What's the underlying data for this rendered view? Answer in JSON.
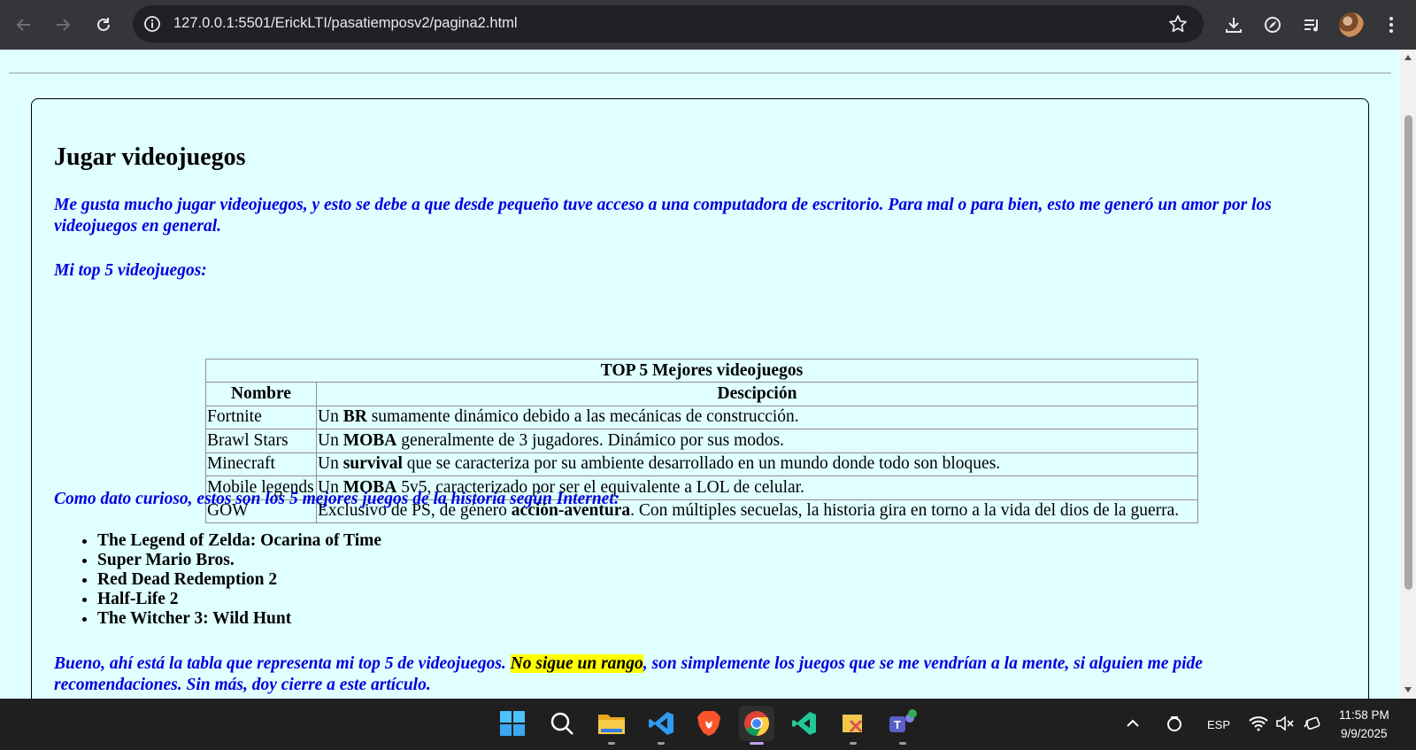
{
  "browser": {
    "url": "127.0.0.1:5501/ErickLTI/pasatiemposv2/pagina2.html"
  },
  "article": {
    "title": "Jugar videojuegos",
    "intro": "Me gusta mucho jugar videojuegos, y esto se debe a que desde pequeño tuve acceso a una computadora de escritorio. Para mal o para bien, esto me generó un amor por los videojuegos en general.",
    "top5_heading": "Mi top 5 videojuegos:",
    "table": {
      "caption": "TOP 5 Mejores videojuegos",
      "headers": [
        "Nombre",
        "Descipción"
      ],
      "rows": [
        {
          "name": "Fortnite",
          "pre": "Un ",
          "bold": "BR",
          "post": " sumamente dinámico debido a las mecánicas de construcción."
        },
        {
          "name": "Brawl Stars",
          "pre": "Un ",
          "bold": "MOBA",
          "post": " generalmente de 3 jugadores. Dinámico por sus modos."
        },
        {
          "name": "Minecraft",
          "pre": "Un ",
          "bold": "survival",
          "post": " que se caracteriza por su ambiente desarrollado en un mundo donde todo son bloques."
        },
        {
          "name": "Mobile legends",
          "pre": "Un ",
          "bold": "MOBA",
          "post": " 5v5, caracterizado por ser el equivalente a LOL de celular."
        },
        {
          "name": "GOW",
          "pre": "Exclusivo de PS, de género ",
          "bold": "acción-aventura",
          "post": ". Con múltiples secuelas, la historia gira en torno a la vida del dios de la guerra."
        }
      ]
    },
    "curious_fact": "Como dato curioso, estos son los 5 mejores juegos de la historia según Internet:",
    "best_games": [
      "The Legend of Zelda: Ocarina of Time",
      "Super Mario Bros.",
      "Red Dead Redemption 2",
      "Half-Life 2",
      "The Witcher 3: Wild Hunt"
    ],
    "closing": {
      "pre": "Bueno, ahí está la tabla que representa mi top 5 de videojuegos. ",
      "highlight": "No sigue un rango",
      "post": ", son simplemente los juegos que se me vendrían a la mente, si alguien me pide recomendaciones. Sin más, doy cierre a este artículo."
    }
  },
  "taskbar": {
    "language": "ESP",
    "time": "11:58 PM",
    "date": "9/9/2025",
    "apps": [
      "start-icon",
      "search-icon",
      "file-explorer-icon",
      "vscode-icon",
      "brave-icon",
      "chrome-icon",
      "visual-studio-icon",
      "tool-icon",
      "teams-icon"
    ]
  },
  "colors": {
    "page_background": "#e0ffff",
    "paragraph_text": "#0000dd",
    "highlight": "#ffff00",
    "browser_toolbar": "#35363a",
    "taskbar": "#1f1f1f"
  }
}
